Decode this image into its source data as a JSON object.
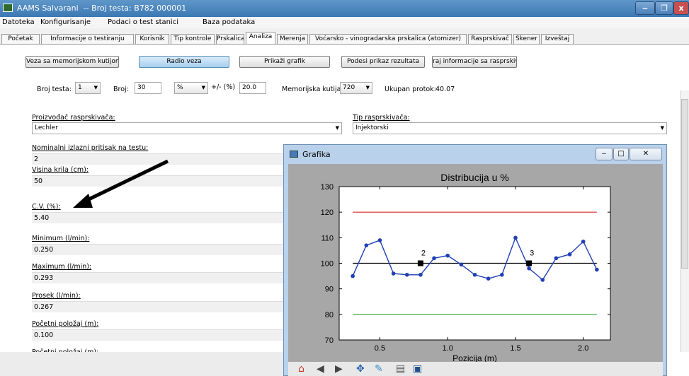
{
  "window": {
    "title": "AAMS Salvarani  -- Broj testa: B782 000001",
    "minimize": "‒",
    "maximize": "❐",
    "close": "x"
  },
  "menu": [
    "Datoteka",
    "Konfigurisanje",
    "Podaci o test stanici",
    "Baza podataka"
  ],
  "tabs": [
    "Početak",
    "Informacije o testiranju",
    "Korisnik",
    "Tip kontrole",
    "Prskalica",
    "Analiza",
    "Merenja",
    "Voćarsko - vinogradarska prskalica (atomizer)",
    "Rasprskivač",
    "Skener",
    "Izveštaj"
  ],
  "active_tab": "Analiza",
  "buttons": {
    "memory": "Veza sa memorijskom kutijom",
    "radio": "Radio veza",
    "graph": "Prikaži grafik",
    "results": "Podesi prikaz rezultata",
    "info": "raj informacije sa rasprskiv"
  },
  "controls": {
    "test_label": "Broj testa:",
    "test_value": "1",
    "count_label": "Broj:",
    "count_value": "30",
    "unit_value": "%",
    "tolerance_label": "+/- (%)",
    "tolerance_value": "20.0",
    "box_label": "Memorijska kutija:",
    "box_value": "720",
    "flow_label": "Ukupan protok:",
    "flow_value": "40.07"
  },
  "manufacturer": {
    "label": "Proizvođač rasprskivača:",
    "value": "Lechler"
  },
  "nozzle_type": {
    "label": "Tip rasprskivača:",
    "value": "Injektorski"
  },
  "properties": [
    {
      "label": "Nominalni izlazni pritisak na testu:",
      "value": "2"
    },
    {
      "label": "Visina krila (cm):",
      "value": "50"
    },
    {
      "label": "C.V. (%):",
      "value": "5.40"
    },
    {
      "label": "Minimum (l/min):",
      "value": "0.250"
    },
    {
      "label": "Maximum (l/min):",
      "value": "0.293"
    },
    {
      "label": "Prosek (l/min):",
      "value": "0.267"
    },
    {
      "label": "Početni položaj (m):",
      "value": "0.100"
    },
    {
      "label": "Početni položaj (m):",
      "value": ""
    }
  ],
  "popup": {
    "title": "Grafika"
  },
  "icons": [
    "home-icon",
    "back-icon",
    "forward-icon",
    "pan-icon",
    "zoom-icon",
    "configure-icon",
    "save-icon"
  ],
  "colors": {
    "upper_line": "#d62728",
    "lower_line": "#2ca02c",
    "series": "#1f3fb4",
    "arrow": "#000000"
  },
  "chart_data": {
    "type": "line",
    "title": "Distribucija u %",
    "xlabel": "Pozicija (m)",
    "ylabel": "",
    "xlim": [
      0.2,
      2.2
    ],
    "ylim": [
      70,
      130
    ],
    "xticks": [
      0.5,
      1.0,
      1.5,
      2.0
    ],
    "xtick_labels": [
      "0.5",
      "1.0",
      "1.5",
      "2.0"
    ],
    "yticks": [
      70,
      80,
      90,
      100,
      110,
      120,
      130
    ],
    "ytick_labels": [
      "70",
      "80",
      "90",
      "100",
      "110",
      "120",
      "130"
    ],
    "series": [
      {
        "x": [
          0.3,
          0.4,
          0.5,
          0.6,
          0.7,
          0.8,
          0.9,
          1.0,
          1.1,
          1.2,
          1.3,
          1.4,
          1.5,
          1.6,
          1.7,
          1.8,
          1.9,
          2.0,
          2.1
        ],
        "values": [
          95,
          107,
          109,
          96,
          95.5,
          95.5,
          102,
          103,
          99.5,
          95.5,
          94,
          95.5,
          110,
          98,
          93.5,
          102,
          103.5,
          108.5,
          97.5
        ]
      }
    ],
    "reference_lines": [
      {
        "y": 120
      },
      {
        "y": 100
      },
      {
        "y": 80
      }
    ],
    "markers": [
      {
        "x": 0.8,
        "y": 100,
        "label": "2"
      },
      {
        "x": 1.6,
        "y": 100,
        "label": "3"
      }
    ],
    "grid": false
  }
}
